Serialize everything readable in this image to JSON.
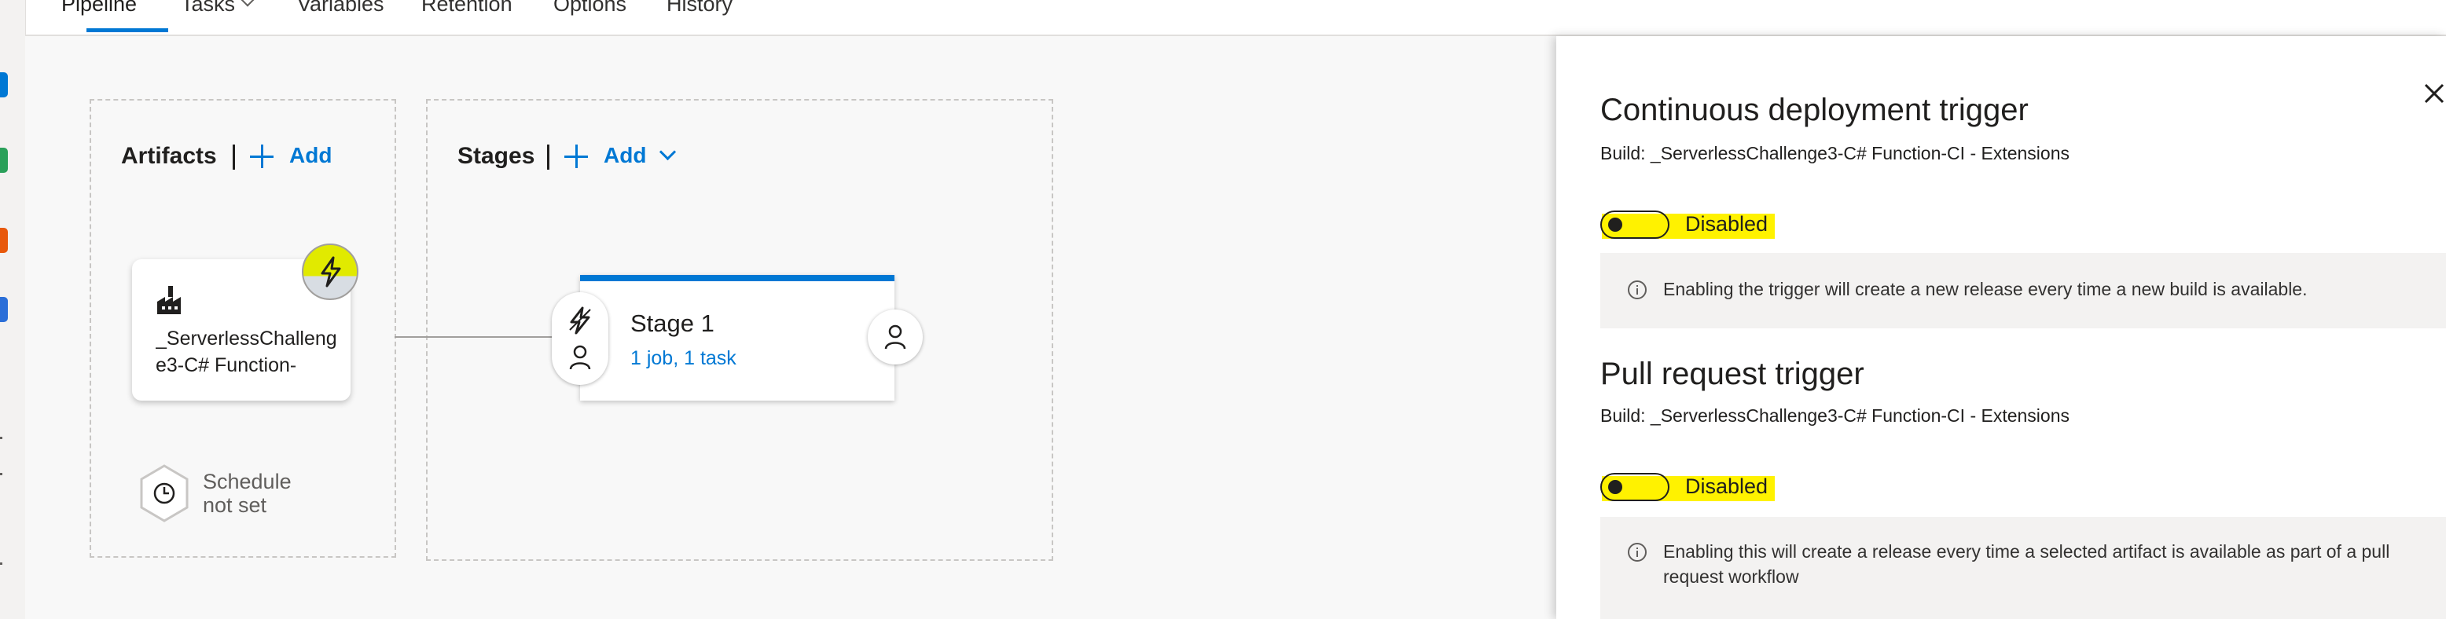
{
  "tabs": [
    {
      "label": "Pipeline",
      "active": true
    },
    {
      "label": "Tasks",
      "has_dropdown": true
    },
    {
      "label": "Variables"
    },
    {
      "label": "Retention"
    },
    {
      "label": "Options"
    },
    {
      "label": "History"
    }
  ],
  "artifacts": {
    "title": "Artifacts",
    "add_label": "Add",
    "card": {
      "name": "_ServerlessChallenge3-C# Function-",
      "icon": "build-factory-icon",
      "trigger_icon": "lightning-icon"
    },
    "schedule": {
      "line1": "Schedule",
      "line2": "not set",
      "icon": "clock-icon"
    }
  },
  "stages": {
    "title": "Stages",
    "add_label": "Add",
    "stage": {
      "name": "Stage 1",
      "summary": "1 job, 1 task",
      "pre_icons": [
        "lightning-icon",
        "person-icon"
      ],
      "post_icon": "person-icon"
    }
  },
  "panel": {
    "close_icon": "close-icon",
    "highlight_color": "#fff200",
    "sections": [
      {
        "title": "Continuous deployment trigger",
        "build": "Build: _ServerlessChallenge3-C# Function-CI - Extensions",
        "toggle_label": "Disabled",
        "enabled": false,
        "info": "Enabling the trigger will create a new release every time a new build is available."
      },
      {
        "title": "Pull request trigger",
        "build": "Build: _ServerlessChallenge3-C# Function-CI - Extensions",
        "toggle_label": "Disabled",
        "enabled": false,
        "info": "Enabling this will create a release every time a selected artifact is available as part of a pull request workflow"
      }
    ]
  },
  "colors": {
    "accent": "#0078d4",
    "trigger_badge": "#e1ea00"
  }
}
